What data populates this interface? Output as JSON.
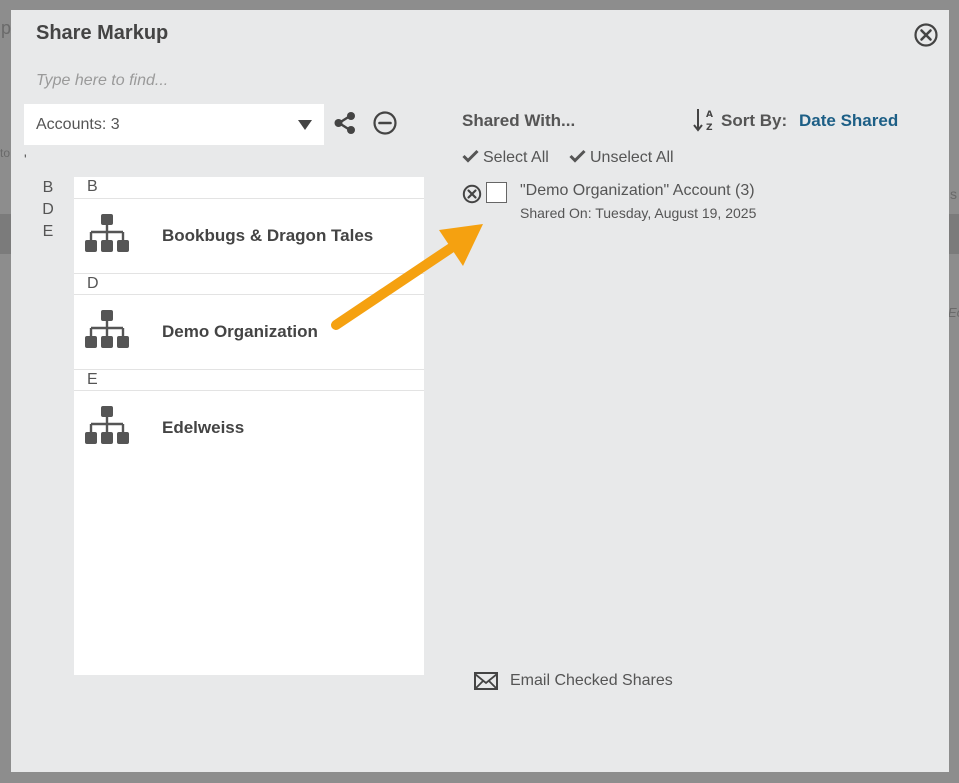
{
  "modal": {
    "title": "Share Markup",
    "search_placeholder": "Type here to find..."
  },
  "accounts_select": {
    "value": "Accounts: 3"
  },
  "comma": "'",
  "alpha_index": [
    "B",
    "D",
    "E"
  ],
  "list": {
    "groups": [
      {
        "letter": "B",
        "name": "Bookbugs & Dragon Tales"
      },
      {
        "letter": "D",
        "name": "Demo Organization"
      },
      {
        "letter": "E",
        "name": "Edelweiss"
      }
    ]
  },
  "shared_panel": {
    "heading": "Shared With...",
    "sort_label": "Sort By:",
    "sort_value": "Date Shared",
    "select_all": "Select All",
    "unselect_all": "Unselect All",
    "share_entry": {
      "account": "\"Demo Organization\" Account (3)",
      "shared_on": "Shared On: Tuesday, August 19, 2025"
    },
    "email_label": "Email Checked Shares"
  },
  "background": {
    "left_snip": "to",
    "top_snip": "p",
    "right_snip": "s",
    "right_snip2": "Eo"
  },
  "colors": {
    "accent": "#1d5f86",
    "arrow": "#f5a110",
    "icon": "#555555"
  }
}
